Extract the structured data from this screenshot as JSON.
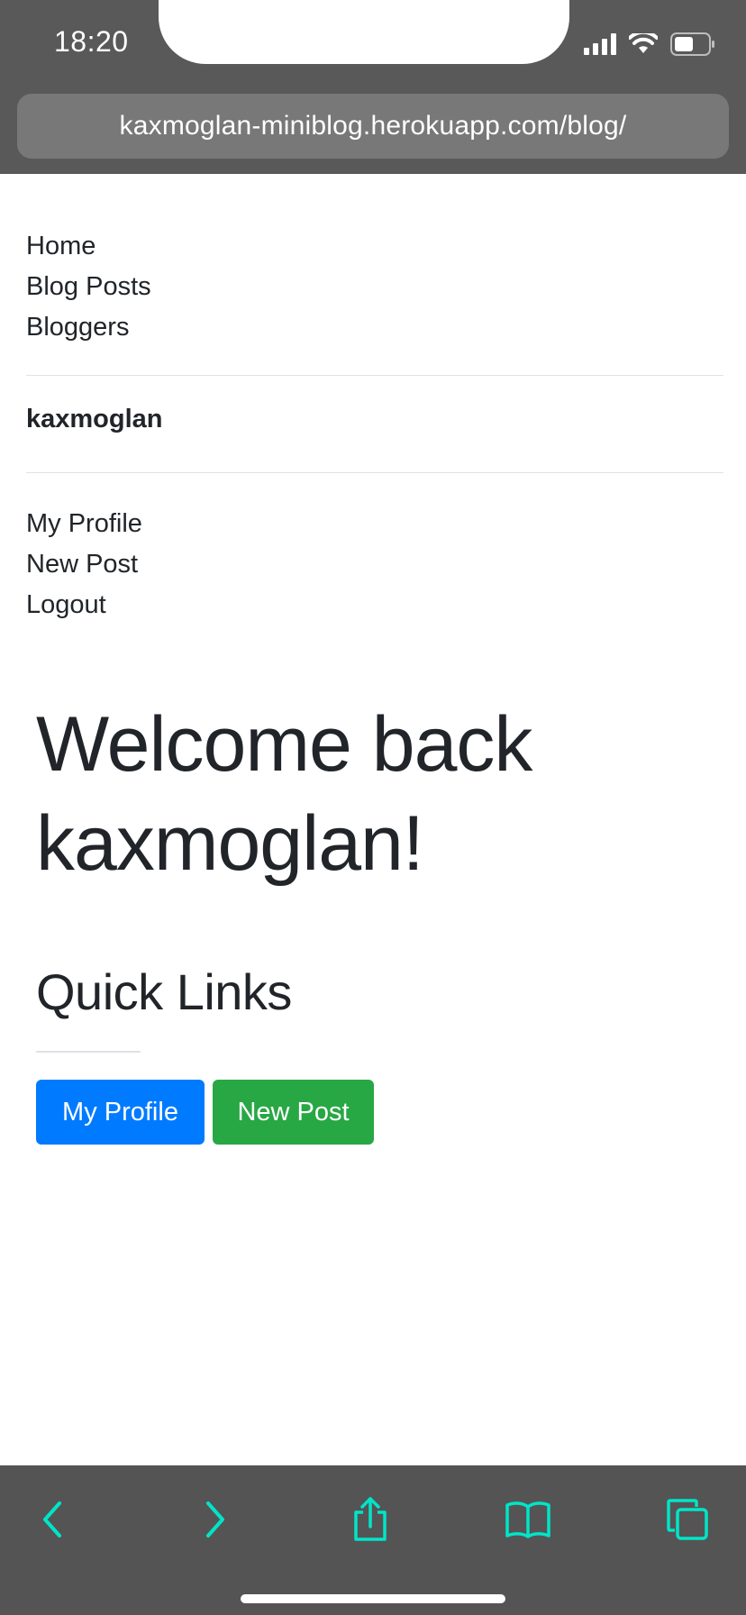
{
  "status_bar": {
    "time": "18:20"
  },
  "browser": {
    "url": "kaxmoglan-miniblog.herokuapp.com/blog/",
    "accent_color": "#00e5c8"
  },
  "nav": {
    "main_links": [
      "Home",
      "Blog Posts",
      "Bloggers"
    ],
    "username": "kaxmoglan",
    "user_links": [
      "My Profile",
      "New Post",
      "Logout"
    ]
  },
  "main": {
    "welcome_heading": "Welcome back kaxmoglan!",
    "quick_links_heading": "Quick Links",
    "buttons": {
      "profile": {
        "label": "My Profile",
        "color": "#007bff"
      },
      "new_post": {
        "label": "New Post",
        "color": "#28a745"
      }
    }
  },
  "toolbar": {
    "icons": [
      "back-icon",
      "forward-icon",
      "share-icon",
      "bookmarks-icon",
      "tabs-icon"
    ]
  }
}
